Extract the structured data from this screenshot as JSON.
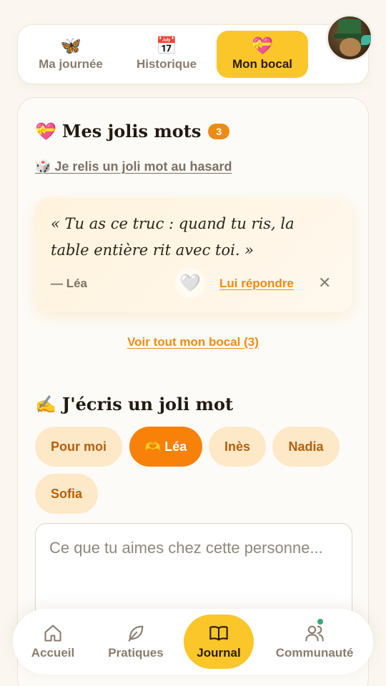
{
  "top_tabs": [
    {
      "label": "Ma journée",
      "icon": "butterfly-icon",
      "glyph": "🦋"
    },
    {
      "label": "Historique",
      "icon": "calendar-icon",
      "glyph": "📅"
    },
    {
      "label": "Mon bocal",
      "icon": "gift-heart-icon",
      "glyph": "💝",
      "active": true
    }
  ],
  "jolis_mots": {
    "title": "Mes jolis mots",
    "title_glyph": "💝",
    "count": "3",
    "random_link": "🎲 Je relis un joli mot au hasard",
    "quote": {
      "text": "« Tu as ce truc : quand tu ris, la table entière rit avec toi. »",
      "author": "— Léa",
      "heart_glyph": "🤍",
      "reply": "Lui répondre",
      "close": "✕"
    },
    "see_all": "Voir tout mon bocal (3)"
  },
  "write": {
    "title": "J'écris un joli mot",
    "title_glyph": "✍️",
    "recipients": [
      {
        "label": "Pour moi"
      },
      {
        "label": "🫶 Léa",
        "active": true
      },
      {
        "label": "Inès"
      },
      {
        "label": "Nadia"
      },
      {
        "label": "Sofia"
      }
    ],
    "placeholder": "Ce que tu aimes chez cette personne..."
  },
  "bottom_nav": [
    {
      "label": "Accueil",
      "icon": "home-icon"
    },
    {
      "label": "Pratiques",
      "icon": "leaf-icon"
    },
    {
      "label": "Journal",
      "icon": "book-icon",
      "active": true
    },
    {
      "label": "Communauté",
      "icon": "users-icon",
      "has_notification": true
    }
  ],
  "colors": {
    "accent_yellow": "#fbc62a",
    "accent_orange": "#f8810a",
    "chip_bg": "#fde8c8",
    "notification": "#3aa86f"
  }
}
